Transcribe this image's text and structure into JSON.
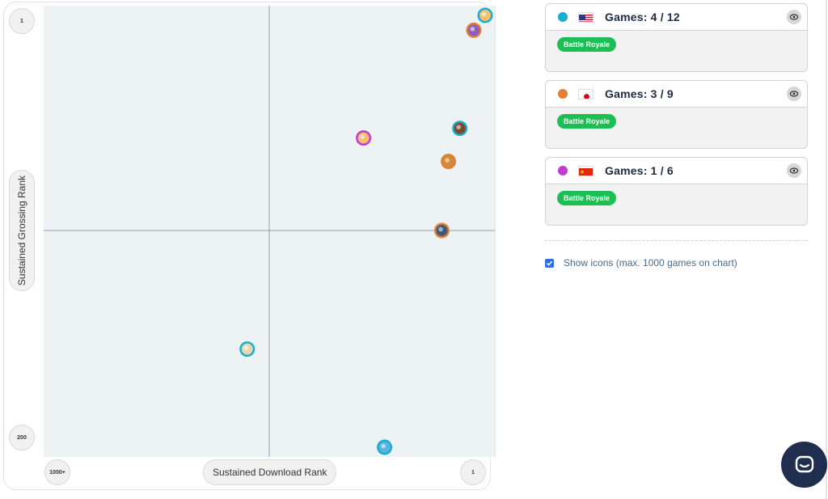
{
  "chart_data": {
    "type": "scatter",
    "xlabel": "Sustained Download Rank",
    "ylabel": "Sustained Grossing Rank",
    "x_axis": {
      "left_label": "1000+",
      "right_label": "1",
      "min": 1000,
      "max": 1,
      "scale": "log"
    },
    "y_axis": {
      "top_label": "1",
      "bottom_label": "200",
      "min": 1,
      "max": 200,
      "scale": "log"
    },
    "quadrant_lines": true,
    "series": [
      {
        "color": "#19aecd",
        "points": [
          {
            "x": 1,
            "y": 1
          },
          {
            "x": 1.5,
            "y": 4
          },
          {
            "x": 45,
            "y": 60
          },
          {
            "x": 5,
            "y": 200
          }
        ]
      },
      {
        "color": "#e08030",
        "points": [
          {
            "x": 1.2,
            "y": 1.2
          },
          {
            "x": 1.8,
            "y": 6
          },
          {
            "x": 2,
            "y": 14
          }
        ]
      },
      {
        "color": "#c33ad3",
        "points": [
          {
            "x": 7,
            "y": 4.5
          }
        ]
      }
    ]
  },
  "panel": {
    "cards": [
      {
        "dot_color": "#19aecd",
        "flag": "us-flag-icon",
        "games": "Games: 4 / 12",
        "tag": "Battle Royale"
      },
      {
        "dot_color": "#e08030",
        "flag": "jp-flag-icon",
        "games": "Games: 3 / 9",
        "tag": "Battle Royale"
      },
      {
        "dot_color": "#c33ad3",
        "flag": "cn-flag-icon",
        "games": "Games: 1 / 6",
        "tag": "Battle Royale"
      }
    ],
    "show_icons": {
      "checked": true,
      "label": "Show icons (max. 1000 games on chart)"
    }
  },
  "icons": {
    "card_toggle": "eye-icon",
    "chat": "chat-icon",
    "checkbox": "check-icon"
  }
}
